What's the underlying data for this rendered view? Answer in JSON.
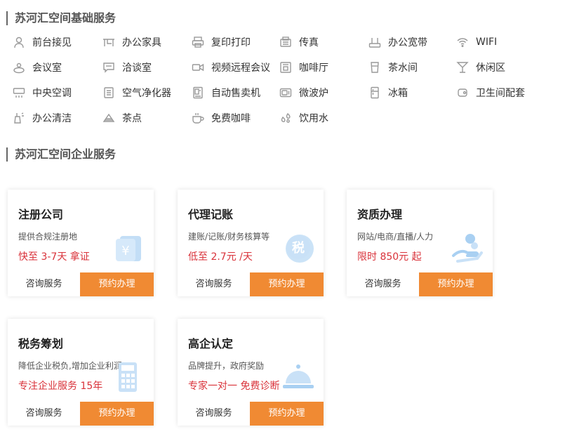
{
  "colors": {
    "accent": "#f08a33",
    "price": "#d9323a",
    "icon": "#999999",
    "illustration": "#a9d0f2"
  },
  "sections": {
    "basic_title": "苏河汇空间基础服务",
    "enterprise_title": "苏河汇空间企业服务"
  },
  "facilities": [
    [
      {
        "label": "前台接见",
        "icon": "person-icon"
      },
      {
        "label": "办公家具",
        "icon": "desk-icon"
      },
      {
        "label": "复印打印",
        "icon": "printer-icon"
      },
      {
        "label": "传真",
        "icon": "fax-icon"
      },
      {
        "label": "办公宽带",
        "icon": "router-icon"
      },
      {
        "label": "WIFI",
        "icon": "wifi-icon"
      }
    ],
    [
      {
        "label": "会议室",
        "icon": "meeting-room-icon"
      },
      {
        "label": "洽谈室",
        "icon": "chat-room-icon"
      },
      {
        "label": "视频远程会议",
        "icon": "video-camera-icon"
      },
      {
        "label": "咖啡厅",
        "icon": "coffee-machine-icon"
      },
      {
        "label": "茶水间",
        "icon": "tea-cup-icon"
      },
      {
        "label": "休闲区",
        "icon": "cocktail-icon"
      }
    ],
    [
      {
        "label": "中央空调",
        "icon": "air-conditioner-icon"
      },
      {
        "label": "空气净化器",
        "icon": "air-purifier-icon"
      },
      {
        "label": "自动售卖机",
        "icon": "vending-machine-icon"
      },
      {
        "label": "微波炉",
        "icon": "microwave-icon"
      },
      {
        "label": "冰箱",
        "icon": "fridge-icon"
      },
      {
        "label": "卫生间配套",
        "icon": "toilet-icon"
      }
    ],
    [
      {
        "label": "办公清洁",
        "icon": "cleaning-icon"
      },
      {
        "label": "茶点",
        "icon": "snack-icon"
      },
      {
        "label": "免费咖啡",
        "icon": "coffee-cup-icon"
      },
      {
        "label": "饮用水",
        "icon": "water-drops-icon"
      }
    ]
  ],
  "cards": [
    {
      "title": "注册公司",
      "desc": "提供合规注册地",
      "price": "快至 3-7天 拿证",
      "consult": "咨询服务",
      "book": "预约办理",
      "icon": "yuan-icon"
    },
    {
      "title": "代理记账",
      "desc": "建账/记账/财务核算等",
      "price": "低至 2.7元 /天",
      "consult": "咨询服务",
      "book": "预约办理",
      "icon": "tax-badge-icon"
    },
    {
      "title": "资质办理",
      "desc": "网站/电商/直播/人力",
      "price": "限时 850元 起",
      "consult": "咨询服务",
      "book": "预约办理",
      "icon": "hand-coin-icon"
    },
    {
      "title": "税务筹划",
      "desc": "降低企业税负,增加企业利润",
      "price": "专注企业服务 15年",
      "consult": "咨询服务",
      "book": "预约办理",
      "icon": "calculator-icon"
    },
    {
      "title": "高企认定",
      "desc": "品牌提升，政府奖励",
      "price": "专家一对一 免费诊断",
      "consult": "咨询服务",
      "book": "预约办理",
      "icon": "service-bell-icon"
    }
  ]
}
